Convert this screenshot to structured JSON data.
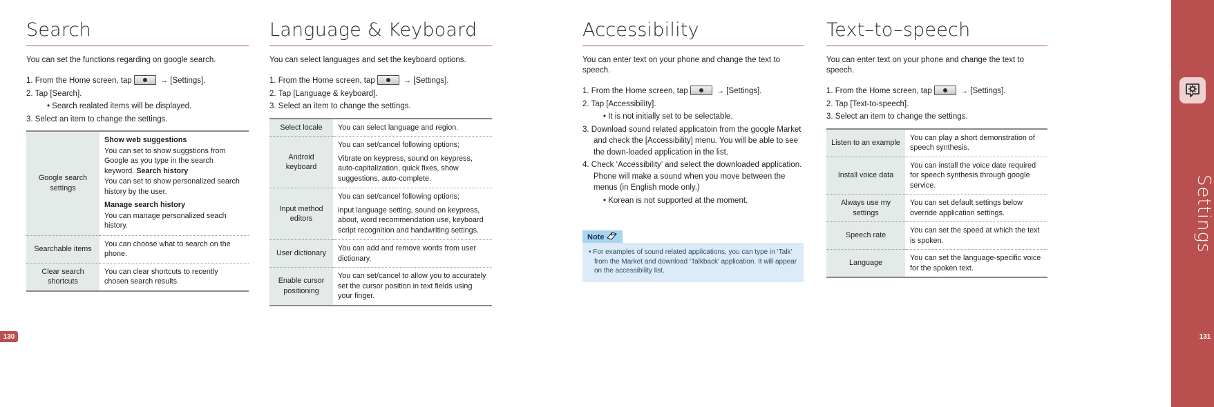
{
  "sidebar": {
    "label": "Settings",
    "icon": "settings-gear-icon",
    "accent_color": "#b9504f"
  },
  "page_numbers": {
    "left": "130",
    "right": "131"
  },
  "home_key_icon": "home-key-icon",
  "arrow_glyph": "→",
  "sections": [
    {
      "id": "search",
      "title": "Search",
      "intro": "You can set the functions regarding on google search.",
      "steps": [
        {
          "type": "num",
          "text": "1. From the Home screen, tap",
          "has_key": true,
          "after": "[Settings]."
        },
        {
          "type": "num",
          "text": "2. Tap [Search]."
        },
        {
          "type": "sub",
          "text": "• Search realated items will be displayed."
        },
        {
          "type": "num",
          "text": "3.  Select an item to change the settings."
        }
      ],
      "table": [
        {
          "key": "Google search settings",
          "blocks": [
            {
              "bold": "Show web suggestions"
            },
            {
              "text": "You can set to show suggstions from Google as you type in the search keyword. ",
              "bold_tail": "Search history"
            },
            {
              "text": "You can set to show personalized search history by the user."
            },
            {
              "bold": "Manage search history"
            },
            {
              "text": "You can manage personalized seach history."
            }
          ]
        },
        {
          "key": "Searchable items",
          "blocks": [
            {
              "text": "You can choose what to search on the phone."
            }
          ]
        },
        {
          "key": "Clear search shortcuts",
          "blocks": [
            {
              "text": "You can clear shortcuts to recently chosen search results."
            }
          ]
        }
      ]
    },
    {
      "id": "language-keyboard",
      "title": "Language & Keyboard",
      "intro": "You can select languages and set the keyboard options.",
      "steps": [
        {
          "type": "num",
          "text": "1. From the Home screen, tap",
          "has_key": true,
          "after": "[Settings]."
        },
        {
          "type": "num",
          "text": "2.  Tap [Language & keyboard]."
        },
        {
          "type": "num",
          "text": "3.  Select an item to change the settings."
        }
      ],
      "table": [
        {
          "key": "Select locale",
          "blocks": [
            {
              "text": "You can select language and region."
            }
          ]
        },
        {
          "key": "Android keyboard",
          "blocks": [
            {
              "text": "You can set/cancel following options;"
            },
            {
              "text": "Vibrate on keypress, sound on keypress, auto-capitalization, quick fixes, show suggestions, auto-complete.",
              "gap": true
            }
          ]
        },
        {
          "key": "Input method editors",
          "blocks": [
            {
              "text": "You can set/cancel following options;"
            },
            {
              "text": "input language setting, sound on keypress, about, word recommendation use, keyboard script recognition and handwriting settings.",
              "gap": true
            }
          ]
        },
        {
          "key": "User dictionary",
          "blocks": [
            {
              "text": "You can add and remove words from user dictionary."
            }
          ]
        },
        {
          "key": "Enable cursor positioning",
          "blocks": [
            {
              "text": "You can set/cancel to allow you to accurately set the cursor position in text fields using your finger."
            }
          ]
        }
      ]
    },
    {
      "id": "accessibility",
      "title": "Accessibility",
      "intro": "You can enter text on your phone and change the text to speech.",
      "steps": [
        {
          "type": "num",
          "text": "1. From the Home screen, tap",
          "has_key": true,
          "after": "[Settings]."
        },
        {
          "type": "num",
          "text": "2.  Tap [Accessibility]."
        },
        {
          "type": "sub",
          "text": "• It is not initially set to be selectable."
        },
        {
          "type": "num",
          "text": "3.  Download sound related applicatoin from the google Market and check the [Accessibility] menu. You will be able to see the down-loaded application in the list."
        },
        {
          "type": "num",
          "text": "4. Check ‘Accessibility’ and select the downloaded application. Phone will make a sound when you move between the menus (in English mode only.)"
        },
        {
          "type": "sub",
          "text": "• Korean is not supported at the moment."
        }
      ],
      "note": {
        "label": "Note",
        "icon": "note-page-icon",
        "items": [
          "• For examples of sound related applications, you can type in ‘Talk’ from the Market and download ‘Talkback’ application. It will appear on the accessibility list."
        ]
      }
    },
    {
      "id": "text-to-speech",
      "title": "Text–to–speech",
      "intro": "You can enter text on your phone and change the text to speech.",
      "steps": [
        {
          "type": "num",
          "text": "1. From the Home screen, tap",
          "has_key": true,
          "after": "[Settings]."
        },
        {
          "type": "num",
          "text": "2.  Tap [Text-to-speech]."
        },
        {
          "type": "num",
          "text": "3.  Select an item to change the settings."
        }
      ],
      "table": [
        {
          "key": "Listen to an example",
          "blocks": [
            {
              "text": "You can play a short demonstration of speech synthesis."
            }
          ]
        },
        {
          "key": "Install voice data",
          "blocks": [
            {
              "text": "You can install the voice date required for speech synthesis through google service."
            }
          ]
        },
        {
          "key": "Always use my settings",
          "blocks": [
            {
              "text": "You can set default settings below override application settings."
            }
          ]
        },
        {
          "key": "Speech rate",
          "blocks": [
            {
              "text": "You can set the speed at which the text is spoken."
            }
          ]
        },
        {
          "key": "Language",
          "blocks": [
            {
              "text": "You can set the language-specific voice for the spoken text."
            }
          ]
        }
      ]
    }
  ]
}
